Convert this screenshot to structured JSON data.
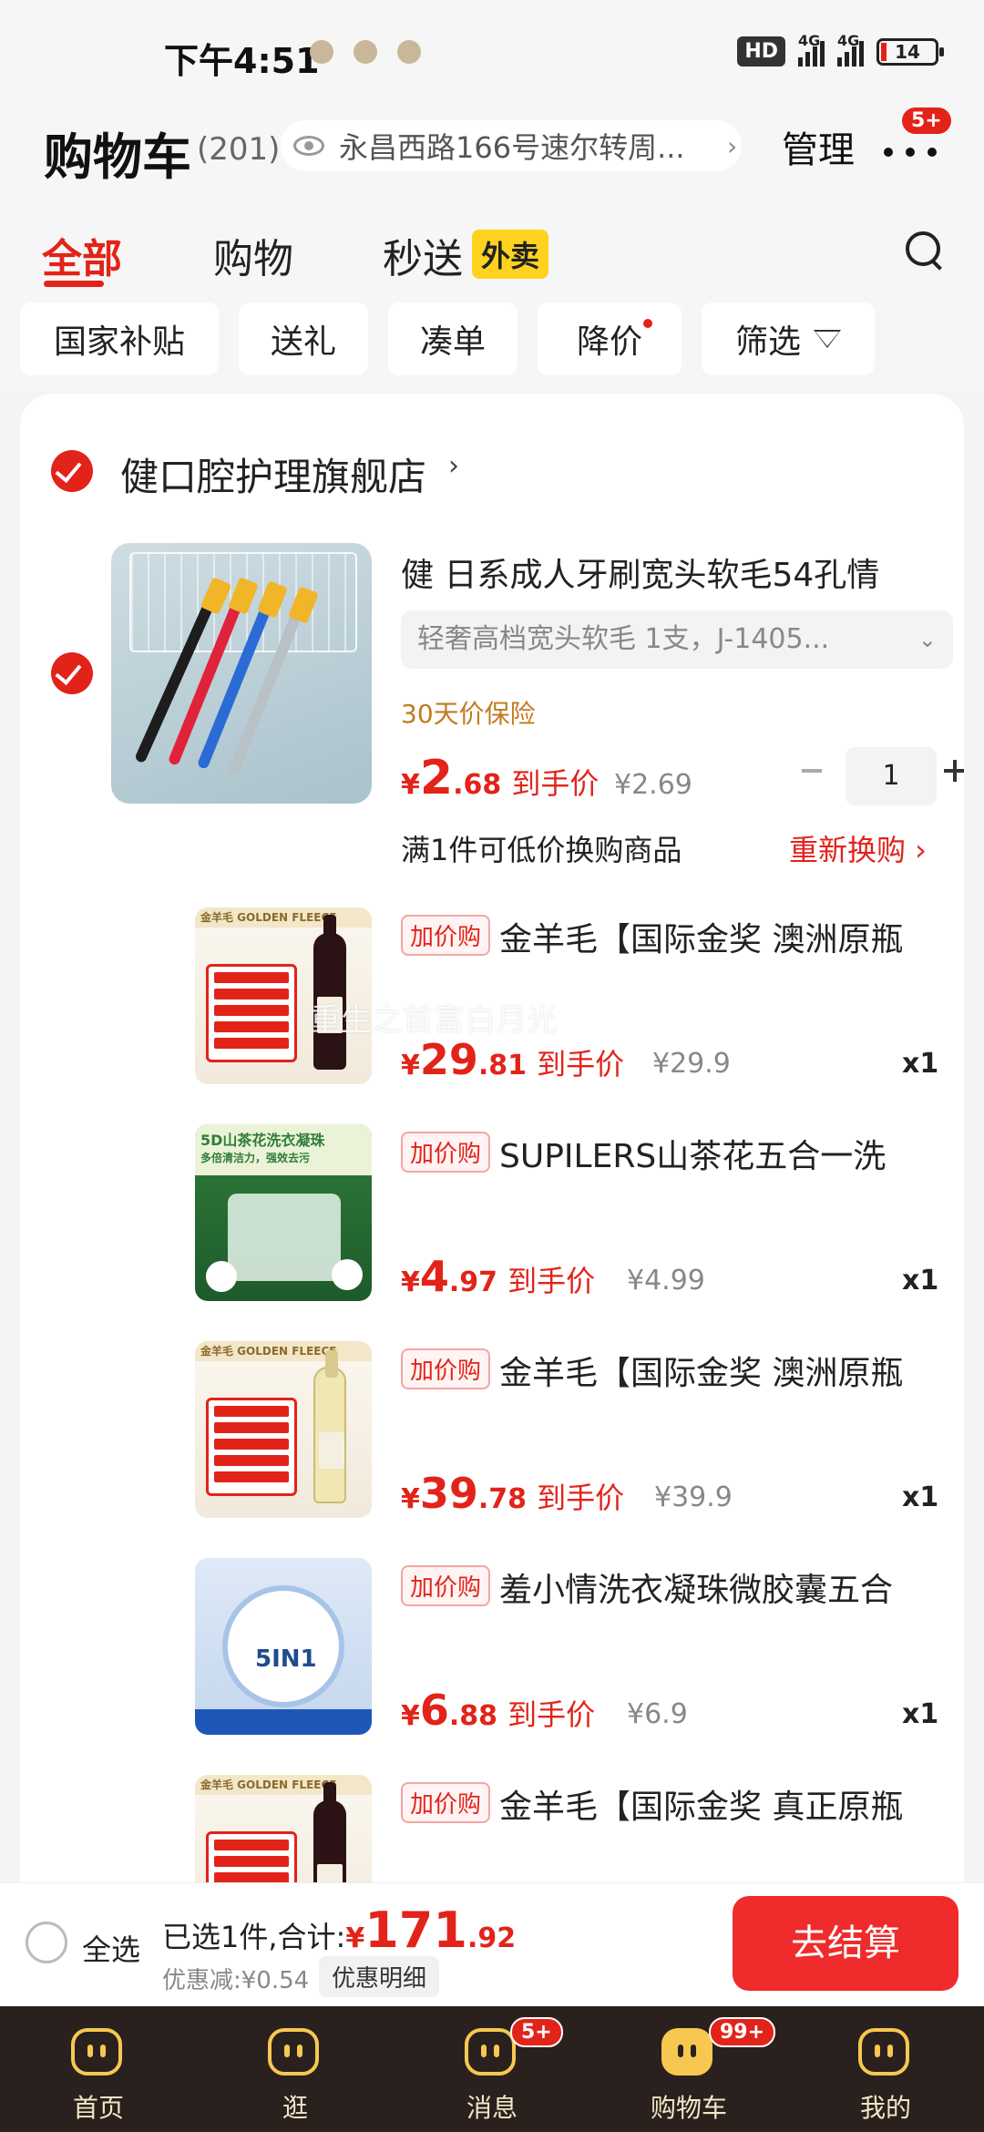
{
  "status_bar": {
    "time": "下午4:51",
    "hd": "HD",
    "net1": "4G",
    "net2": "4G",
    "battery": "14"
  },
  "header": {
    "title": "购物车",
    "count": "(201)",
    "address": "永昌西路166号速尔转周...",
    "manage": "管理",
    "more_badge": "5+"
  },
  "tabs": [
    {
      "label": "全部"
    },
    {
      "label": "购物"
    },
    {
      "label": "秒送"
    }
  ],
  "waimai_badge": "外卖",
  "filters": [
    {
      "label": "国家补贴"
    },
    {
      "label": "送礼"
    },
    {
      "label": "凑单"
    },
    {
      "label": "降价"
    },
    {
      "label": "筛选"
    }
  ],
  "store": {
    "name": "健口腔护理旗舰店",
    "chevron": "›"
  },
  "main_item": {
    "title": "健 日系成人牙刷宽头软毛54孔情",
    "sku": "轻奢高档宽头软毛 1支，J-1405...",
    "insurance": "30天价保险",
    "price_yen": "¥",
    "price_int": "2",
    "price_dec": ".68",
    "price_label": "到手价",
    "orig_price": "¥2.69",
    "qty": "1",
    "exchange_text": "满1件可低价换购商品",
    "exchange_link": "重新换购 ›"
  },
  "addon_badge": "加价购",
  "addons": [
    {
      "title": "金羊毛【国际金奖 澳洲原瓶",
      "yen": "¥",
      "int": "29",
      "dec": ".81",
      "label": "到手价",
      "orig": "¥29.9",
      "qty": "x1"
    },
    {
      "title": "SUPILERS山茶花五合一洗",
      "yen": "¥",
      "int": "4",
      "dec": ".97",
      "label": "到手价",
      "orig": "¥4.99",
      "qty": "x1"
    },
    {
      "title": "金羊毛【国际金奖 澳洲原瓶",
      "yen": "¥",
      "int": "39",
      "dec": ".78",
      "label": "到手价",
      "orig": "¥39.9",
      "qty": "x1"
    },
    {
      "title": "羞小情洗衣凝珠微胶囊五合",
      "yen": "¥",
      "int": "6",
      "dec": ".88",
      "label": "到手价",
      "orig": "¥6.9",
      "qty": "x1"
    },
    {
      "title": "金羊毛【国际金奖 真正原瓶"
    }
  ],
  "thumbs": {
    "wine_brand": "金羊毛 GOLDEN FLEECE",
    "tea_line1": "5D山茶花洗衣凝珠",
    "tea_line2": "多倍清洁力，强效去污",
    "lx_text": "5IN1"
  },
  "watermark": "重生之首富白月光",
  "checkout": {
    "select_all": "全选",
    "selected_prefix": "已选1件,合计:",
    "yen": "¥",
    "total_int": "171",
    "total_dec": ".92",
    "discount": "优惠减:¥0.54",
    "detail": "优惠明细",
    "button": "去结算"
  },
  "nav": [
    {
      "label": "首页"
    },
    {
      "label": "逛"
    },
    {
      "label": "消息",
      "badge": "5+"
    },
    {
      "label": "购物车",
      "badge": "99+"
    },
    {
      "label": "我的"
    }
  ],
  "colors": {
    "accent": "#e2231a",
    "nav_bg": "#2a211e",
    "nav_icon": "#f7c850"
  }
}
